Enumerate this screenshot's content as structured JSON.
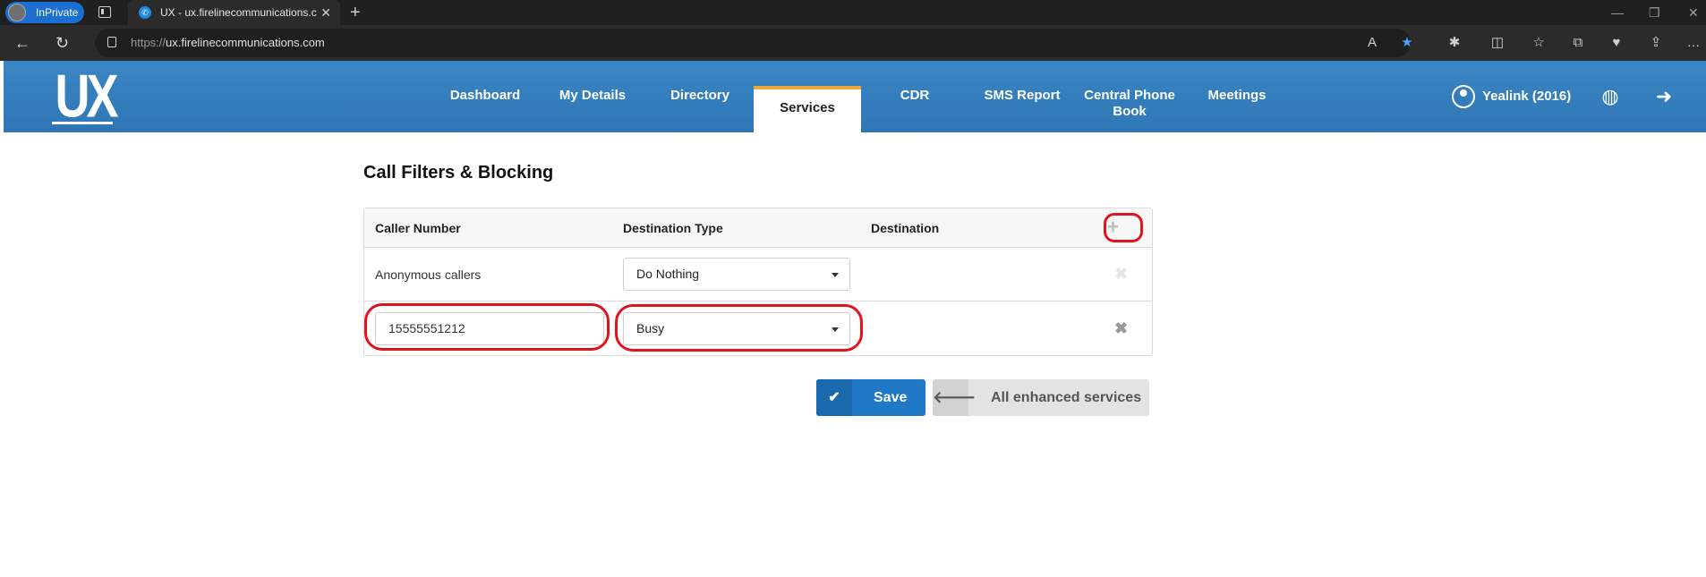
{
  "browser": {
    "inprivate_label": "InPrivate",
    "tab_title": "UX - ux.firelinecommunications.c",
    "url_scheme": "https://",
    "url_host": "ux.firelinecommunications.com"
  },
  "app": {
    "logo_text": "UX",
    "nav": [
      {
        "label": "Dashboard"
      },
      {
        "label": "My Details"
      },
      {
        "label": "Directory"
      },
      {
        "label": "Services"
      },
      {
        "label": "CDR"
      },
      {
        "label": "SMS Report"
      },
      {
        "label": "Central Phone Book"
      },
      {
        "label": "Meetings"
      }
    ],
    "active_nav": "Services",
    "user_label": "Yealink (2016)"
  },
  "page": {
    "title": "Call Filters & Blocking",
    "columns": [
      "Caller Number",
      "Destination Type",
      "Destination"
    ],
    "rows": [
      {
        "caller": "Anonymous callers",
        "destination_type": "Do Nothing",
        "destination": ""
      },
      {
        "caller": "15555551212",
        "destination_type": "Busy",
        "destination": ""
      }
    ],
    "save_label": "Save",
    "back_label": "All enhanced services"
  },
  "icons": {
    "add": "plus-icon",
    "delete": "times-icon",
    "save": "check-icon",
    "back": "arrow-left-icon",
    "globe": "globe-icon",
    "logout": "sign-out-icon",
    "user": "user-circle-icon"
  },
  "colors": {
    "header_blue": "#3b86c4",
    "active_tab_accent": "#f0a43c",
    "save_blue": "#2079c7",
    "annotation_red": "#e0141e"
  }
}
